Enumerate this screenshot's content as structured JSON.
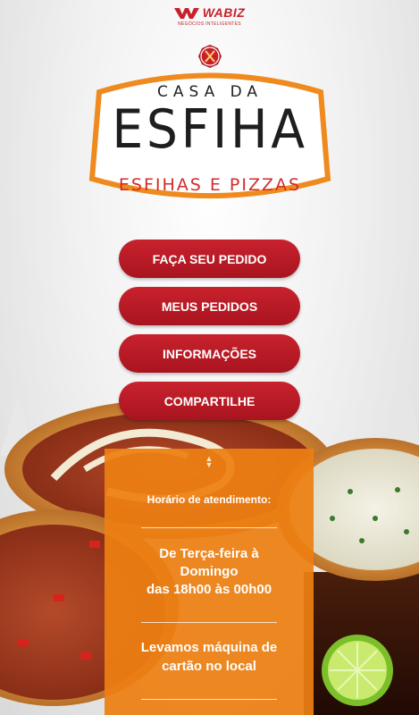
{
  "brand": {
    "name": "WABIZ",
    "tagline": "NEGÓCIOS INTELIGENTES",
    "color": "#c8202b"
  },
  "logo": {
    "top_line": "CASA DA",
    "main_line": "ESFIHA",
    "sub_line": "ESFIHAS E PIZZAS",
    "icon": "fork-knife-icon",
    "colors": {
      "frame": "#ee8a1e",
      "badge": "#c8202b",
      "title": "#1e1e1e",
      "subtitle": "#d42a2a"
    }
  },
  "menu": {
    "items": [
      {
        "label": "FAÇA SEU PEDIDO"
      },
      {
        "label": "MEUS PEDIDOS"
      },
      {
        "label": "INFORMAÇÕES"
      },
      {
        "label": "COMPARTILHE"
      }
    ],
    "color": "#b51a25"
  },
  "info_panel": {
    "toggle_icon": "expand-collapse-icon",
    "label": "Horário de atendimento:",
    "hours_line1": "De Terça-feira à",
    "hours_line2": "Domingo",
    "hours_line3": "das 18h00 às 00h00",
    "card_line1": "Levamos máquina de",
    "card_line2": "cartão no local",
    "color": "#ed7f12"
  }
}
